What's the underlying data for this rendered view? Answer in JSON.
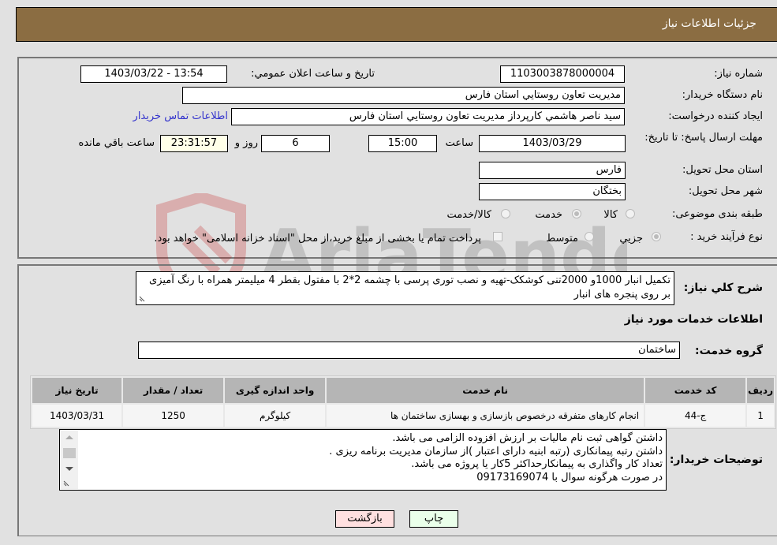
{
  "header": {
    "title": "جزئیات اطلاعات نیاز"
  },
  "fields": {
    "need_number_label": "شماره نیاز:",
    "need_number": "1103003878000004",
    "announce_label": "تاریخ و ساعت اعلان عمومي:",
    "announce_value": "1403/03/22 - 13:54",
    "buyer_org_label": "نام دستگاه خريدار:",
    "buyer_org": "مديريت تعاون روستايي استان فارس",
    "creator_label": "ايجاد کننده درخواست:",
    "creator": "سيد ناصر هاشمي کارپرداز مديريت تعاون روستايي استان فارس",
    "contact_link": "اطلاعات تماس خريدار",
    "deadline_label": "مهلت ارسال پاسخ: تا تاریخ:",
    "deadline_date": "1403/03/29",
    "time_label": "ساعت",
    "deadline_time": "15:00",
    "days_value": "6",
    "days_label": "روز و",
    "remaining_time": "23:31:57",
    "remaining_label": "ساعت باقي مانده",
    "province_label": "استان محل تحويل:",
    "province": "فارس",
    "city_label": "شهر محل تحويل:",
    "city": "بختگان",
    "category_label": "طبقه بندی موضوعی:",
    "category_options": [
      {
        "label": "کالا",
        "checked": false
      },
      {
        "label": "خدمت",
        "checked": true
      },
      {
        "label": "کالا/خدمت",
        "checked": false
      }
    ],
    "process_label": "نوع فرآيند خريد :",
    "process_options": [
      {
        "label": "جزيي",
        "checked": true
      },
      {
        "label": "متوسط",
        "checked": false
      }
    ],
    "treasury_note": "پرداخت تمام يا بخشی از مبلغ خريد،از محل \"اسناد خزانه اسلامی\" خواهد بود."
  },
  "watermark": {
    "text": "AriaTender.net"
  },
  "description": {
    "label": "شرح کلي نياز:",
    "text": "تکمیل انبار 1000و 2000تنی کوشکک-تهیه و نصب توری پرسی با چشمه 2*2 با مفتول بقطر 4 میلیمتر همراه با رنگ آمیزی  بر روی پنجره های انبار"
  },
  "services": {
    "section_title": "اطلاعات خدمات مورد نياز",
    "group_label": "گروه خدمت:",
    "group_value": "ساختمان",
    "table": {
      "headers": [
        "رديف",
        "کد خدمت",
        "نام خدمت",
        "واحد اندازه گيری",
        "تعداد / مقدار",
        "تاريخ نياز"
      ],
      "rows": [
        [
          "1",
          "ج-44",
          "انجام کارهای متفرقه درخصوص بازسازی و بهسازی ساختمان ها",
          "کيلوگرم",
          "1250",
          "1403/03/31"
        ]
      ]
    }
  },
  "buyer_notes": {
    "label": "توضيحات خريدار:",
    "lines": [
      "داشتن گواهی ثبت نام مالیات بر ارزش افزوده الزامی می باشد.",
      "داشتن رتبه پیمانکاری (رتبه ابنیه دارای اعتبار )از سازمان مدیریت برنامه ریزی .",
      "تعداد کار واگذاری به پیمانکارحداکثر 5کار یا پروژه می باشد.",
      "در صورت هرگونه سوال با 09173169074"
    ]
  },
  "buttons": {
    "print": "چاپ",
    "back": "بازگشت"
  }
}
